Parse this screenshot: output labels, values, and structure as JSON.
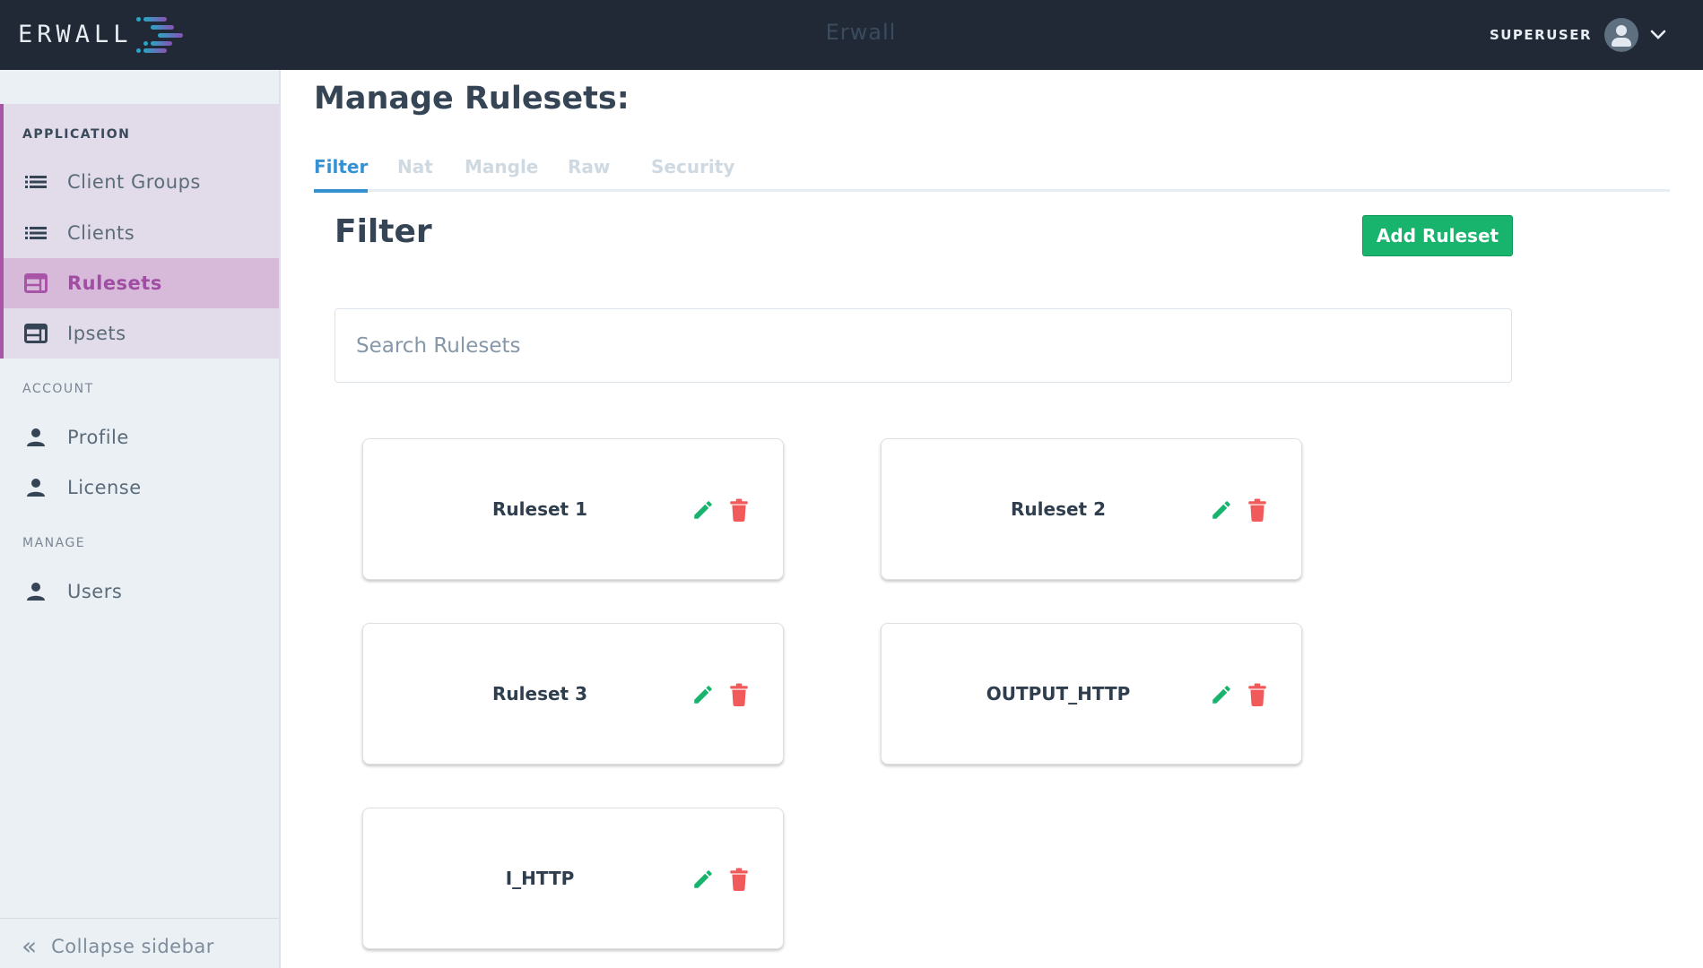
{
  "header": {
    "logo_text": "ERWALL",
    "app_title": "Erwall",
    "user_name": "SUPERUSER",
    "avatar_icon": "user-circle-icon",
    "menu_icon": "chevron-down-icon"
  },
  "sidebar": {
    "sections": [
      {
        "label": "APPLICATION",
        "items": [
          {
            "label": "Client Groups",
            "icon": "list-icon",
            "active": false
          },
          {
            "label": "Clients",
            "icon": "list-icon",
            "active": false
          },
          {
            "label": "Rulesets",
            "icon": "table-icon",
            "active": true
          },
          {
            "label": "Ipsets",
            "icon": "table-icon",
            "active": false
          }
        ]
      },
      {
        "label": "ACCOUNT",
        "items": [
          {
            "label": "Profile",
            "icon": "user-icon",
            "active": false
          },
          {
            "label": "License",
            "icon": "user-icon",
            "active": false
          }
        ]
      },
      {
        "label": "MANAGE",
        "items": [
          {
            "label": "Users",
            "icon": "user-icon",
            "active": false
          }
        ]
      }
    ],
    "collapse_label": "Collapse sidebar",
    "collapse_icon": "double-chevron-left-icon"
  },
  "main": {
    "page_title": "Manage Rulesets:",
    "tabs": [
      {
        "label": "Filter",
        "active": true
      },
      {
        "label": "Nat",
        "active": false
      },
      {
        "label": "Mangle",
        "active": false
      },
      {
        "label": "Raw",
        "active": false
      },
      {
        "label": "Security",
        "active": false
      }
    ],
    "section_title": "Filter",
    "add_button_label": "Add Ruleset",
    "search": {
      "placeholder": "Search Rulesets",
      "value": ""
    },
    "rulesets": [
      {
        "name": "Ruleset 1"
      },
      {
        "name": "Ruleset 2"
      },
      {
        "name": "Ruleset 3"
      },
      {
        "name": "OUTPUT_HTTP"
      },
      {
        "name": "I_HTTP"
      }
    ]
  },
  "colors": {
    "header_bg": "#212936",
    "accent_purple": "#a855a8",
    "tab_active": "#3691d3",
    "add_button": "#18b46e",
    "edit_icon": "#18b46e",
    "delete_icon": "#f05a5a"
  }
}
